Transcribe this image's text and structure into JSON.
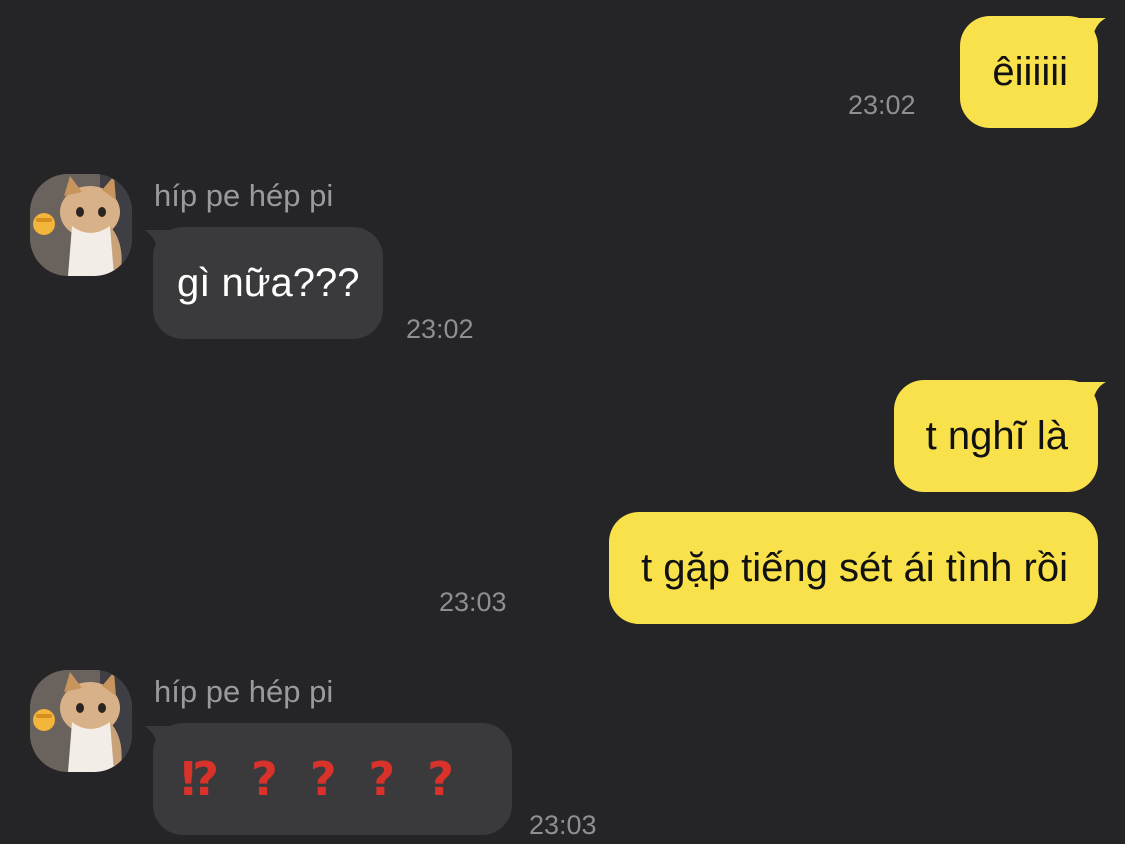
{
  "conversation": {
    "contact_name": "híp pe hép pi",
    "messages": [
      {
        "direction": "out",
        "text": "êiiiiii",
        "time": "23:02"
      },
      {
        "direction": "in",
        "sender": "híp pe hép pi",
        "text": "gì nữa???",
        "time": "23:02"
      },
      {
        "direction": "out",
        "text": "t nghĩ là"
      },
      {
        "direction": "out",
        "text": "t gặp tiếng sét ái tình rồi",
        "time": "23:03"
      },
      {
        "direction": "in",
        "sender": "híp pe hép pi",
        "emojis": [
          "⁉",
          "?",
          "?",
          "?",
          "?"
        ],
        "time": "23:03"
      }
    ]
  },
  "avatar": {
    "icon": "cat-avatar-icon",
    "badge": "fist-emoji-icon"
  },
  "colors": {
    "background": "#252527",
    "outgoing_bubble": "#f8e14a",
    "incoming_bubble": "#3a3a3c",
    "timestamp": "#8e8e93",
    "emoji_red": "#d8322a"
  }
}
